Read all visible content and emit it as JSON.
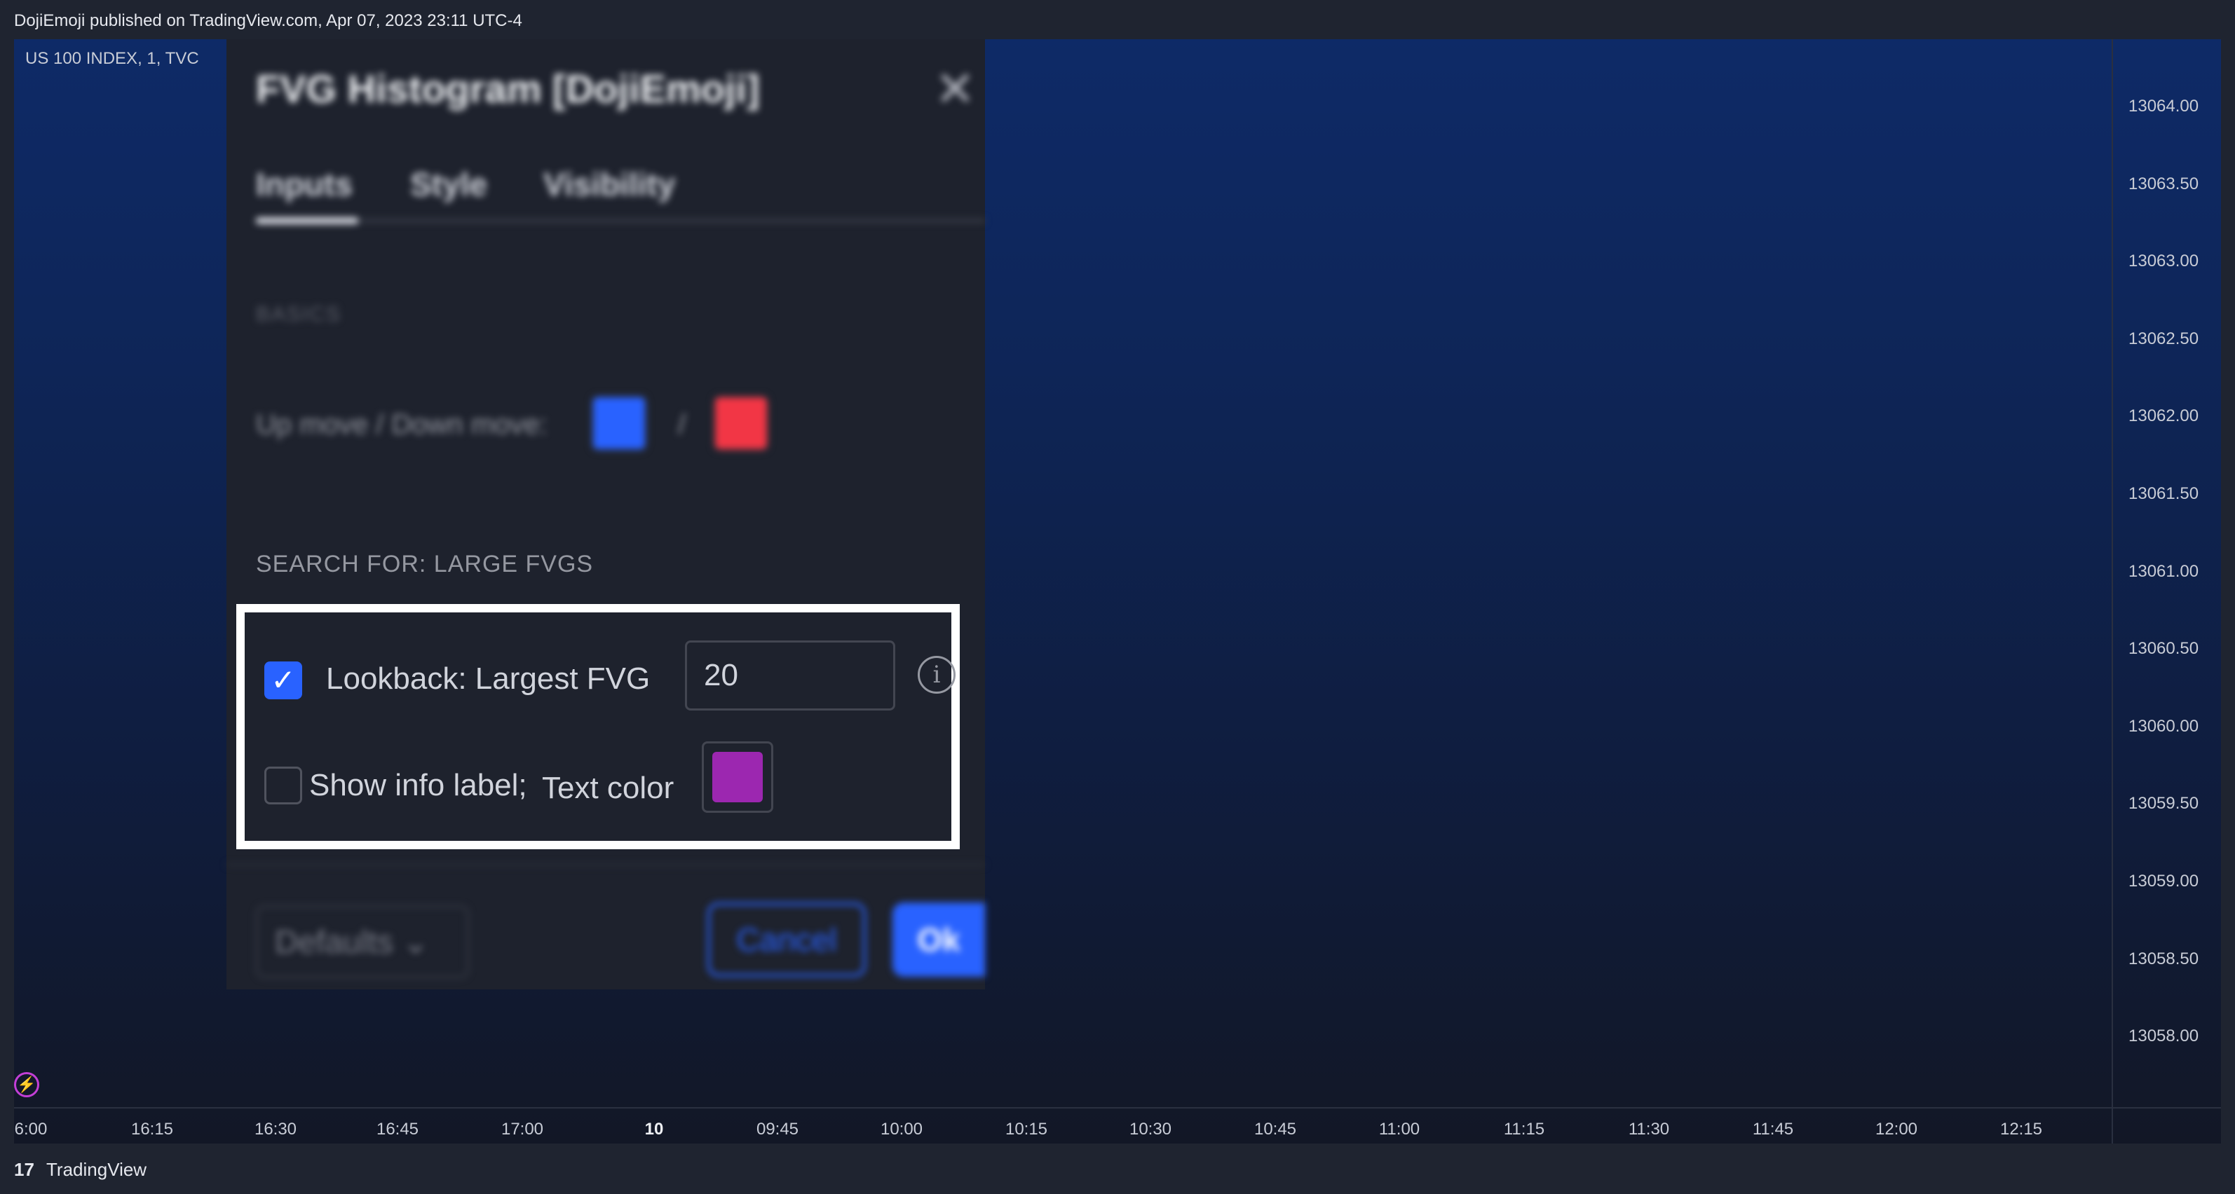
{
  "header": {
    "published": "DojiEmoji published on TradingView.com, Apr 07, 2023 23:11 UTC-4"
  },
  "chart": {
    "symbol": "US 100 INDEX, 1, TVC",
    "price_labels": [
      "13064.00",
      "13063.50",
      "13063.00",
      "13062.50",
      "13062.00",
      "13061.50",
      "13061.00",
      "13060.50",
      "13060.00",
      "13059.50",
      "13059.00",
      "13058.50",
      "13058.00"
    ],
    "time_labels": [
      {
        "text": "6:00",
        "bold": false
      },
      {
        "text": "16:15",
        "bold": false
      },
      {
        "text": "16:30",
        "bold": false
      },
      {
        "text": "16:45",
        "bold": false
      },
      {
        "text": "17:00",
        "bold": false
      },
      {
        "text": "10",
        "bold": true
      },
      {
        "text": "09:45",
        "bold": false
      },
      {
        "text": "10:00",
        "bold": false
      },
      {
        "text": "10:15",
        "bold": false
      },
      {
        "text": "10:30",
        "bold": false
      },
      {
        "text": "10:45",
        "bold": false
      },
      {
        "text": "11:00",
        "bold": false
      },
      {
        "text": "11:15",
        "bold": false
      },
      {
        "text": "11:30",
        "bold": false
      },
      {
        "text": "11:45",
        "bold": false
      },
      {
        "text": "12:00",
        "bold": false
      },
      {
        "text": "12:15",
        "bold": false
      }
    ]
  },
  "dialog": {
    "title": "FVG Histogram [DojiEmoji]",
    "tabs": [
      "Inputs",
      "Style",
      "Visibility"
    ],
    "basics_header": "BASICS",
    "updown_label": "Up move / Down move:",
    "slash": "/",
    "up_color": "#2962ff",
    "down_color": "#f23645",
    "search_header": "SEARCH FOR: LARGE FVGS",
    "lookback": {
      "label": "Lookback: Largest FVG",
      "checked": true,
      "value": "20"
    },
    "info_label": {
      "label": "Show info label;",
      "checked": false,
      "text_color_label": "Text color",
      "text_color": "#9c27b0"
    },
    "defaults_label": "Defaults",
    "cancel_label": "Cancel",
    "ok_label": "Ok"
  },
  "footer": {
    "brand": "TradingView"
  }
}
